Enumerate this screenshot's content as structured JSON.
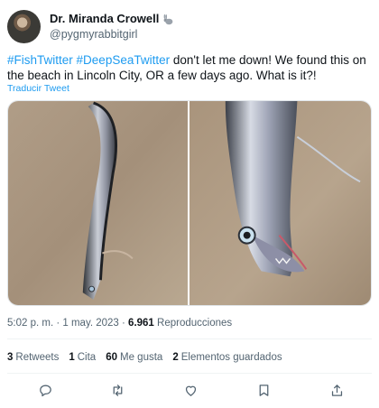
{
  "author": {
    "display_name": "Dr. Miranda Crowell",
    "handle": "@pygmyrabbitgirl"
  },
  "tweet": {
    "hashtag_1": "#FishTwitter",
    "hashtag_2": "#DeepSeaTwitter",
    "body": " don't let me down! We found this on the beach in Lincoln City, OR a few days ago. What is it?!",
    "translate_label": "Traducir Tweet"
  },
  "meta": {
    "time": "5:02 p. m.",
    "separator": " · ",
    "date": "1 may. 2023",
    "views_count": "6.961",
    "views_label": " Reproducciones"
  },
  "stats": {
    "retweets_count": "3",
    "retweets_label": "Retweets",
    "quotes_count": "1",
    "quotes_label": "Cita",
    "likes_count": "60",
    "likes_label": "Me gusta",
    "bookmarks_count": "2",
    "bookmarks_label": "Elementos guardados"
  },
  "icons": {
    "reply": "reply-icon",
    "retweet": "retweet-icon",
    "like": "heart-icon",
    "bookmark": "bookmark-icon",
    "share": "share-icon"
  },
  "colors": {
    "link": "#1d9bf0",
    "secondary_text": "#536471",
    "primary_text": "#0f1419"
  }
}
